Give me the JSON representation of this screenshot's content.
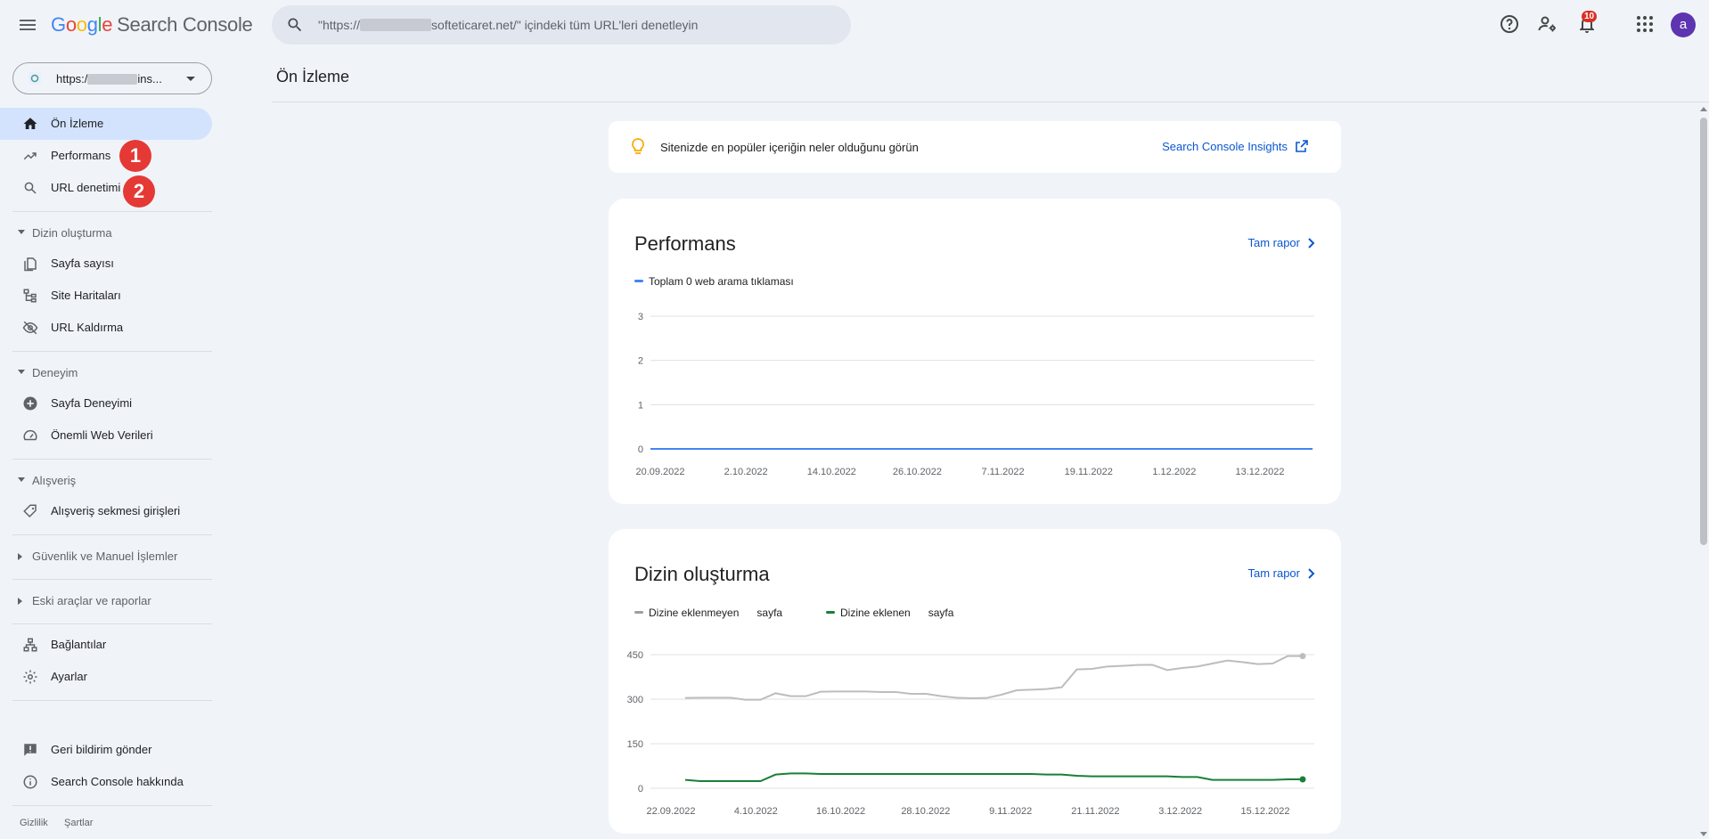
{
  "header": {
    "app_name": "Search Console",
    "logo_letters": [
      "G",
      "o",
      "o",
      "g",
      "l",
      "e"
    ],
    "search_prefix": "\"https://",
    "search_suffix": "softeticaret.net/\" içindeki tüm URL'leri denetleyin",
    "notification_count": "10",
    "avatar_letter": "a"
  },
  "sidebar": {
    "property_prefix": "https:/",
    "property_suffix": "ins...",
    "items": [
      {
        "label": "Ön İzleme",
        "icon": "home-icon"
      },
      {
        "label": "Performans",
        "icon": "trending-up-icon"
      },
      {
        "label": "URL denetimi",
        "icon": "search-icon"
      }
    ],
    "sections": [
      {
        "label": "Dizin oluşturma",
        "items": [
          {
            "label": "Sayfa sayısı",
            "icon": "pages-icon"
          },
          {
            "label": "Site Haritaları",
            "icon": "sitemap-icon"
          },
          {
            "label": "URL Kaldırma",
            "icon": "visibility-off-icon"
          }
        ]
      },
      {
        "label": "Deneyim",
        "items": [
          {
            "label": "Sayfa Deneyimi",
            "icon": "add-circle-icon"
          },
          {
            "label": "Önemli Web Verileri",
            "icon": "speed-icon"
          }
        ]
      },
      {
        "label": "Alışveriş",
        "items": [
          {
            "label": "Alışveriş sekmesi girişleri",
            "icon": "tag-icon"
          }
        ]
      },
      {
        "label": "Güvenlik ve Manuel İşlemler",
        "items": []
      },
      {
        "label": "Eski araçlar ve raporlar",
        "items": []
      }
    ],
    "bottom_items": [
      {
        "label": "Bağlantılar",
        "icon": "links-icon"
      },
      {
        "label": "Ayarlar",
        "icon": "settings-icon"
      },
      {
        "label": "Geri bildirim gönder",
        "icon": "feedback-icon"
      },
      {
        "label": "Search Console hakkında",
        "icon": "info-icon"
      }
    ],
    "footer": {
      "privacy": "Gizlilik",
      "terms": "Şartlar"
    }
  },
  "annotations": [
    "1",
    "2"
  ],
  "main": {
    "page_title": "Ön İzleme",
    "tip": {
      "text": "Sitenizde en popüler içeriğin neler olduğunu görün",
      "link": "Search Console Insights"
    },
    "performance": {
      "title": "Performans",
      "full_report": "Tam rapor",
      "legend": "Toplam 0 web arama tıklaması"
    },
    "indexing": {
      "title": "Dizin oluşturma",
      "full_report": "Tam rapor",
      "legend_not_indexed": "Dizine eklenmeyen",
      "legend_indexed": "Dizine eklenen",
      "legend_unit": "sayfa"
    }
  },
  "colors": {
    "accent": "#0b57d0",
    "not_indexed": "#bdbdbd",
    "indexed": "#188038",
    "clicks": "#4285f4"
  },
  "chart_data": [
    {
      "type": "line",
      "title": "Performans",
      "x": [
        "20.09.2022",
        "2.10.2022",
        "14.10.2022",
        "26.10.2022",
        "7.11.2022",
        "19.11.2022",
        "1.12.2022",
        "13.12.2022"
      ],
      "ylim": [
        0,
        3
      ],
      "yticks": [
        0,
        1,
        2,
        3
      ],
      "series": [
        {
          "name": "Toplam 0 web arama tıklaması",
          "values": [
            0,
            0,
            0,
            0,
            0,
            0,
            0,
            0
          ]
        }
      ]
    },
    {
      "type": "line",
      "title": "Dizin oluşturma",
      "x": [
        "22.09.2022",
        "4.10.2022",
        "16.10.2022",
        "28.10.2022",
        "9.11.2022",
        "21.11.2022",
        "3.12.2022",
        "15.12.2022"
      ],
      "ylim": [
        0,
        450
      ],
      "yticks": [
        0,
        150,
        300,
        450
      ],
      "series": [
        {
          "name": "Dizine eklenmeyen",
          "values": [
            304,
            305,
            305,
            305,
            298,
            298,
            320,
            310,
            310,
            325,
            326,
            326,
            326,
            324,
            324,
            318,
            318,
            310,
            305,
            303,
            304,
            315,
            330,
            332,
            334,
            340,
            400,
            402,
            410,
            412,
            415,
            416,
            398,
            405,
            410,
            420,
            430,
            425,
            418,
            420,
            445,
            445
          ]
        },
        {
          "name": "Dizine eklenen",
          "values": [
            28,
            24,
            24,
            24,
            24,
            24,
            46,
            50,
            50,
            48,
            48,
            48,
            48,
            48,
            48,
            48,
            48,
            48,
            48,
            48,
            48,
            48,
            48,
            48,
            46,
            46,
            42,
            40,
            40,
            40,
            40,
            40,
            40,
            38,
            38,
            28,
            28,
            28,
            28,
            28,
            30,
            30
          ]
        }
      ]
    }
  ]
}
